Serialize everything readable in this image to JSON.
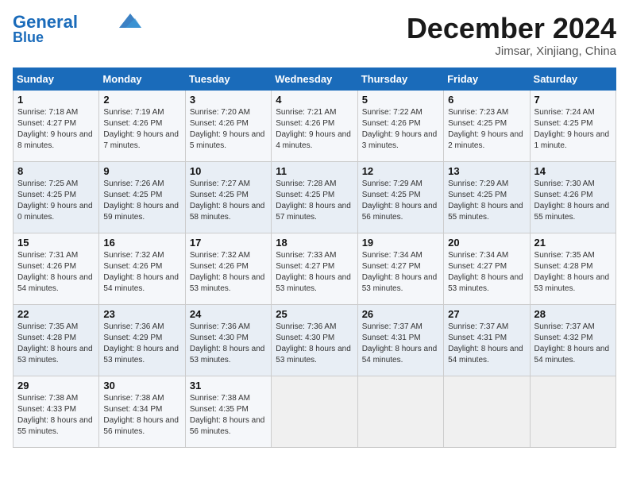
{
  "header": {
    "logo_line1": "General",
    "logo_line2": "Blue",
    "month_title": "December 2024",
    "location": "Jimsar, Xinjiang, China"
  },
  "weekdays": [
    "Sunday",
    "Monday",
    "Tuesday",
    "Wednesday",
    "Thursday",
    "Friday",
    "Saturday"
  ],
  "weeks": [
    [
      {
        "day": "1",
        "sunrise": "7:18 AM",
        "sunset": "4:27 PM",
        "daylight": "9 hours and 8 minutes."
      },
      {
        "day": "2",
        "sunrise": "7:19 AM",
        "sunset": "4:26 PM",
        "daylight": "9 hours and 7 minutes."
      },
      {
        "day": "3",
        "sunrise": "7:20 AM",
        "sunset": "4:26 PM",
        "daylight": "9 hours and 5 minutes."
      },
      {
        "day": "4",
        "sunrise": "7:21 AM",
        "sunset": "4:26 PM",
        "daylight": "9 hours and 4 minutes."
      },
      {
        "day": "5",
        "sunrise": "7:22 AM",
        "sunset": "4:26 PM",
        "daylight": "9 hours and 3 minutes."
      },
      {
        "day": "6",
        "sunrise": "7:23 AM",
        "sunset": "4:25 PM",
        "daylight": "9 hours and 2 minutes."
      },
      {
        "day": "7",
        "sunrise": "7:24 AM",
        "sunset": "4:25 PM",
        "daylight": "9 hours and 1 minute."
      }
    ],
    [
      {
        "day": "8",
        "sunrise": "7:25 AM",
        "sunset": "4:25 PM",
        "daylight": "9 hours and 0 minutes."
      },
      {
        "day": "9",
        "sunrise": "7:26 AM",
        "sunset": "4:25 PM",
        "daylight": "8 hours and 59 minutes."
      },
      {
        "day": "10",
        "sunrise": "7:27 AM",
        "sunset": "4:25 PM",
        "daylight": "8 hours and 58 minutes."
      },
      {
        "day": "11",
        "sunrise": "7:28 AM",
        "sunset": "4:25 PM",
        "daylight": "8 hours and 57 minutes."
      },
      {
        "day": "12",
        "sunrise": "7:29 AM",
        "sunset": "4:25 PM",
        "daylight": "8 hours and 56 minutes."
      },
      {
        "day": "13",
        "sunrise": "7:29 AM",
        "sunset": "4:25 PM",
        "daylight": "8 hours and 55 minutes."
      },
      {
        "day": "14",
        "sunrise": "7:30 AM",
        "sunset": "4:26 PM",
        "daylight": "8 hours and 55 minutes."
      }
    ],
    [
      {
        "day": "15",
        "sunrise": "7:31 AM",
        "sunset": "4:26 PM",
        "daylight": "8 hours and 54 minutes."
      },
      {
        "day": "16",
        "sunrise": "7:32 AM",
        "sunset": "4:26 PM",
        "daylight": "8 hours and 54 minutes."
      },
      {
        "day": "17",
        "sunrise": "7:32 AM",
        "sunset": "4:26 PM",
        "daylight": "8 hours and 53 minutes."
      },
      {
        "day": "18",
        "sunrise": "7:33 AM",
        "sunset": "4:27 PM",
        "daylight": "8 hours and 53 minutes."
      },
      {
        "day": "19",
        "sunrise": "7:34 AM",
        "sunset": "4:27 PM",
        "daylight": "8 hours and 53 minutes."
      },
      {
        "day": "20",
        "sunrise": "7:34 AM",
        "sunset": "4:27 PM",
        "daylight": "8 hours and 53 minutes."
      },
      {
        "day": "21",
        "sunrise": "7:35 AM",
        "sunset": "4:28 PM",
        "daylight": "8 hours and 53 minutes."
      }
    ],
    [
      {
        "day": "22",
        "sunrise": "7:35 AM",
        "sunset": "4:28 PM",
        "daylight": "8 hours and 53 minutes."
      },
      {
        "day": "23",
        "sunrise": "7:36 AM",
        "sunset": "4:29 PM",
        "daylight": "8 hours and 53 minutes."
      },
      {
        "day": "24",
        "sunrise": "7:36 AM",
        "sunset": "4:30 PM",
        "daylight": "8 hours and 53 minutes."
      },
      {
        "day": "25",
        "sunrise": "7:36 AM",
        "sunset": "4:30 PM",
        "daylight": "8 hours and 53 minutes."
      },
      {
        "day": "26",
        "sunrise": "7:37 AM",
        "sunset": "4:31 PM",
        "daylight": "8 hours and 54 minutes."
      },
      {
        "day": "27",
        "sunrise": "7:37 AM",
        "sunset": "4:31 PM",
        "daylight": "8 hours and 54 minutes."
      },
      {
        "day": "28",
        "sunrise": "7:37 AM",
        "sunset": "4:32 PM",
        "daylight": "8 hours and 54 minutes."
      }
    ],
    [
      {
        "day": "29",
        "sunrise": "7:38 AM",
        "sunset": "4:33 PM",
        "daylight": "8 hours and 55 minutes."
      },
      {
        "day": "30",
        "sunrise": "7:38 AM",
        "sunset": "4:34 PM",
        "daylight": "8 hours and 56 minutes."
      },
      {
        "day": "31",
        "sunrise": "7:38 AM",
        "sunset": "4:35 PM",
        "daylight": "8 hours and 56 minutes."
      },
      null,
      null,
      null,
      null
    ]
  ]
}
